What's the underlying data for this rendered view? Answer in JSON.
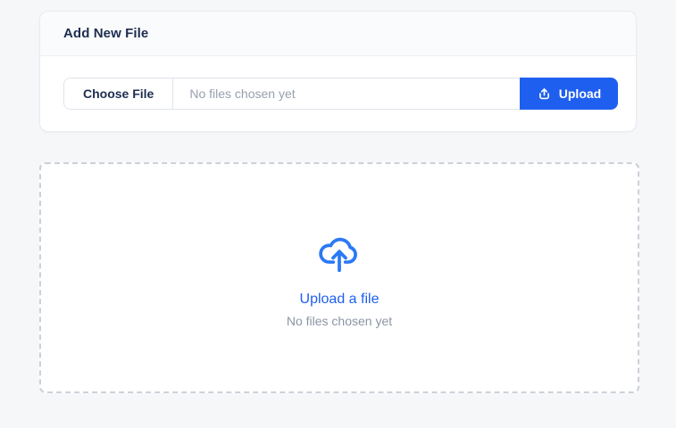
{
  "card": {
    "title": "Add New File",
    "file_input": {
      "choose_file_label": "Choose File",
      "placeholder": "No files chosen yet"
    },
    "upload_button": {
      "label": "Upload",
      "icon": "upload-tray-icon",
      "color": "#1f5ff0",
      "text_color": "#ffffff"
    }
  },
  "dropzone": {
    "icon": "cloud-upload-icon",
    "link_label": "Upload a file",
    "status_text": "No files chosen yet",
    "accent_color": "#2b79f5",
    "border_style": "dashed",
    "border_color": "#ccd1d9"
  }
}
